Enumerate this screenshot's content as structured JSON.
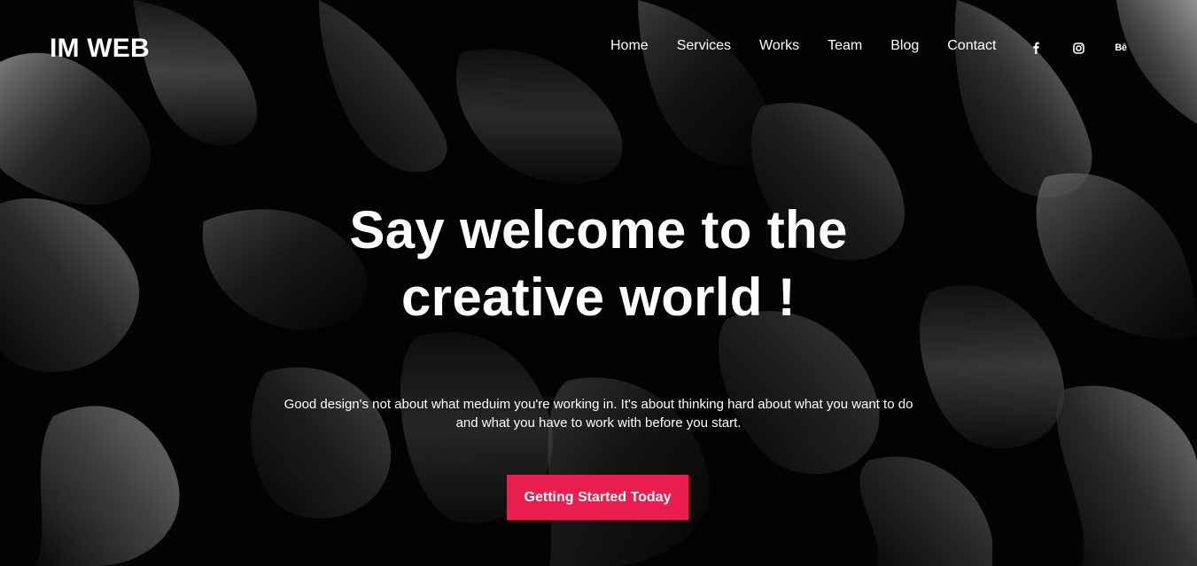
{
  "brand": {
    "logo_text": "IM WEB"
  },
  "nav": {
    "items": [
      {
        "label": "Home"
      },
      {
        "label": "Services"
      },
      {
        "label": "Works"
      },
      {
        "label": "Team"
      },
      {
        "label": "Blog"
      },
      {
        "label": "Contact"
      }
    ]
  },
  "social": {
    "items": [
      {
        "icon": "facebook-icon"
      },
      {
        "icon": "instagram-icon"
      },
      {
        "icon": "behance-icon",
        "glyph": "Bē"
      }
    ]
  },
  "hero": {
    "headline_line1": "Say welcome to the",
    "headline_line2": "creative world !",
    "subtext_line1": "Good design's not about what meduim you're working in. It's about thinking hard about what you want to do",
    "subtext_line2": "and what you have to work with before you start.",
    "cta_label": "Getting Started Today"
  },
  "colors": {
    "background": "#050505",
    "accent": "#e91e4f",
    "text": "#ffffff"
  }
}
